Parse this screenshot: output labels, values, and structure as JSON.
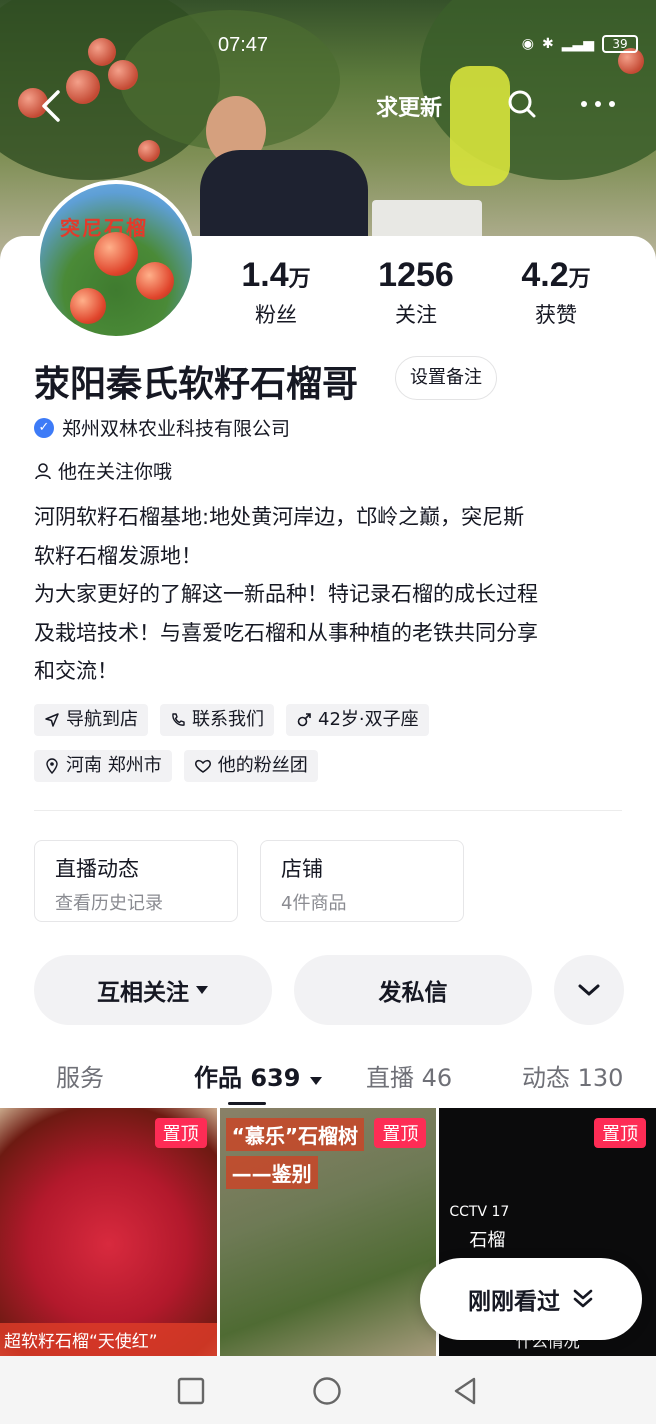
{
  "status_bar": {
    "time": "07:47",
    "battery": "39"
  },
  "topnav": {
    "update_label": "求更新"
  },
  "profile": {
    "name": "荥阳秦氏软籽石榴哥",
    "remark_label": "设置备注",
    "verified_org": "郑州双林农业科技有限公司",
    "follows_you": "他在关注你哦",
    "avatar_text": "突尼石榴",
    "stats": [
      {
        "num": "1.4",
        "unit": "万",
        "label": "粉丝"
      },
      {
        "num": "1256",
        "unit": "",
        "label": "关注"
      },
      {
        "num": "4.2",
        "unit": "万",
        "label": "获赞"
      }
    ],
    "bio_lines": [
      "河阴软籽石榴基地:地处黄河岸边，邙岭之巅，突尼斯",
      "软籽石榴发源地！",
      "为大家更好的了解这一新品种！特记录石榴的成长过程",
      "及栽培技术！与喜爱吃石榴和从事种植的老铁共同分享",
      "和交流！"
    ],
    "tags": {
      "navigate": "导航到店",
      "contact": "联系我们",
      "age": "42岁·双子座",
      "location": "河南 郑州市",
      "fan_club": "他的粉丝团"
    }
  },
  "entries": {
    "live": {
      "title": "直播动态",
      "sub": "查看历史记录"
    },
    "shop": {
      "title": "店铺",
      "sub": "4件商品"
    }
  },
  "actions": {
    "mutual": "互相关注",
    "message": "发私信"
  },
  "tabs": {
    "service": "服务",
    "works": "作品 639",
    "live": "直播 46",
    "posts": "动态 130"
  },
  "videos": [
    {
      "pin": "置顶",
      "caption": "超软籽石榴“天使红”"
    },
    {
      "pin": "置顶",
      "title": "“慕乐”石榴树",
      "sub": "——鉴别"
    },
    {
      "pin": "置顶",
      "badge": "CCTV 17",
      "text": "石榴",
      "caption": "什么情况"
    }
  ],
  "recent_label": "刚刚看过",
  "colors": {
    "accent": "#fe2c55",
    "verify": "#3d7bf7"
  }
}
